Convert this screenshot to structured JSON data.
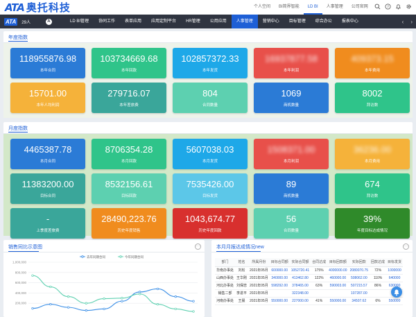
{
  "brand": {
    "mark": "ATA",
    "name": "奥托科技"
  },
  "top_links": [
    "个人空间",
    "BI简界智能",
    "LD BI",
    "人事管理",
    "公司官网"
  ],
  "top_active": 2,
  "nav": {
    "mark": "ATA",
    "user": "29人",
    "circle": "A",
    "items": [
      "LD BI管理",
      "协同工作",
      "表单应用",
      "应用定制平台",
      "HR管理",
      "公用应用",
      "人事管理",
      "营销中心",
      "目标管理",
      "综合办公",
      "报表中心"
    ],
    "active": 6,
    "arrow_left": "‹",
    "arrow_right": "›"
  },
  "annual": {
    "title": "年度指数",
    "cards": [
      {
        "value": "118955876.98",
        "label": "本年合同",
        "color": "#2b7bd6"
      },
      {
        "value": "103734669.68",
        "label": "本年回款",
        "color": "#2fc48a"
      },
      {
        "value": "102857372.33",
        "label": "本年发货",
        "color": "#1ea8e8"
      },
      {
        "value": "16937877.58",
        "label": "本年利润",
        "color": "#e8504a",
        "blur": true
      },
      {
        "value": "409373.15",
        "label": "本年费用",
        "color": "#f08c1e",
        "blur": true
      },
      {
        "value": "15701.00",
        "label": "本年人均利润",
        "color": "#f5b23a"
      },
      {
        "value": "279716.07",
        "label": "本年差旅费",
        "color": "#3aa69a"
      },
      {
        "value": "804",
        "label": "合同数量",
        "color": "#5dd0b0"
      },
      {
        "value": "1069",
        "label": "商机数量",
        "color": "#2b7bd6"
      },
      {
        "value": "8002",
        "label": "拜访数",
        "color": "#2fc48a"
      }
    ]
  },
  "monthly": {
    "title": "月度指数",
    "cards": [
      {
        "value": "4465387.78",
        "label": "本月合同",
        "color": "#2b7bd6"
      },
      {
        "value": "8706354.28",
        "label": "本月回款",
        "color": "#2fc48a"
      },
      {
        "value": "5607038.03",
        "label": "本月发货",
        "color": "#1ea8e8"
      },
      {
        "value": "1508371.00",
        "label": "本月利润",
        "color": "#e8504a",
        "blur": true
      },
      {
        "value": "36236.00",
        "label": "本月费用",
        "color": "#f5b23a",
        "blur": true
      },
      {
        "value": "11383200.00",
        "label": "目标合同",
        "color": "#3aa69a"
      },
      {
        "value": "8532156.61",
        "label": "目标回款",
        "color": "#5dd0b0"
      },
      {
        "value": "7535426.00",
        "label": "目标发货",
        "color": "#5cc7e8"
      },
      {
        "value": "89",
        "label": "商机数量",
        "color": "#2b7bd6"
      },
      {
        "value": "674",
        "label": "拜访数",
        "color": "#2fc48a"
      },
      {
        "value": "-",
        "label": "上季度差旅费",
        "color": "#3aa69a"
      },
      {
        "value": "28490,223.76",
        "label": "历史年度销售",
        "color": "#f08c1e"
      },
      {
        "value": "1043,674.77",
        "label": "历史年度回款",
        "color": "#d8302e"
      },
      {
        "value": "56",
        "label": "合同数量",
        "color": "#5dd0b0"
      },
      {
        "value": "39%",
        "label": "年度目标达成情况",
        "color": "#2f8a2a"
      }
    ]
  },
  "trend": {
    "title": "销售同比示意图",
    "legend": [
      "去年同期合同",
      "今年同期合同"
    ],
    "more": "···"
  },
  "chart_data": {
    "type": "line",
    "title": "销售同比示意图",
    "ylim": [
      0,
      1000000
    ],
    "yticks": [
      "1,000,000",
      "800,000",
      "600,000",
      "400,000",
      "200,000"
    ],
    "series": [
      {
        "name": "去年同期合同",
        "color": "#3a8ee6",
        "values": [
          100000,
          180000,
          120000,
          60000,
          90000,
          240000,
          420000,
          480000,
          330000,
          240000
        ]
      },
      {
        "name": "今年同期合同",
        "color": "#5dd0b0",
        "values": [
          740000,
          520000,
          330000,
          200000,
          290000,
          300000,
          380000,
          180000,
          90000,
          40000
        ]
      }
    ]
  },
  "report": {
    "title": "本月月报达成情况new",
    "more": "···",
    "headers": [
      "部门",
      "姓名",
      "所属月份",
      "目标合同额",
      "实际合同额",
      "合同达成",
      "目标回款额",
      "实际回款",
      "回款达成",
      "目标发货"
    ],
    "rows": [
      [
        "华南办事处",
        "刘松",
        "2021年05月",
        "600000.00",
        "1052720.41",
        "175%",
        "4000000.00",
        "2080070.75",
        "72%",
        "1000000"
      ],
      [
        "山西办事处",
        "王华刚",
        "2021年05月",
        "340000.00",
        "413462.80",
        "122%",
        "460000.00",
        "508062.00",
        "110%",
        "640000"
      ],
      [
        "河北办事处",
        "刘保忠",
        "2021年05月",
        "598292.00",
        "378465.00",
        "63%",
        "590003.00",
        "507215.57",
        "86%",
        "630000"
      ],
      [
        "销售二部",
        "李进平",
        "2021年05月",
        "",
        "322348.00",
        "",
        "",
        "107287.00",
        "",
        ""
      ],
      [
        "河南办事处",
        "王晨",
        "2021年05月",
        "550000.00",
        "227000.00",
        "41%",
        "550000.00",
        "34507.62",
        "6%",
        "550000"
      ]
    ]
  }
}
